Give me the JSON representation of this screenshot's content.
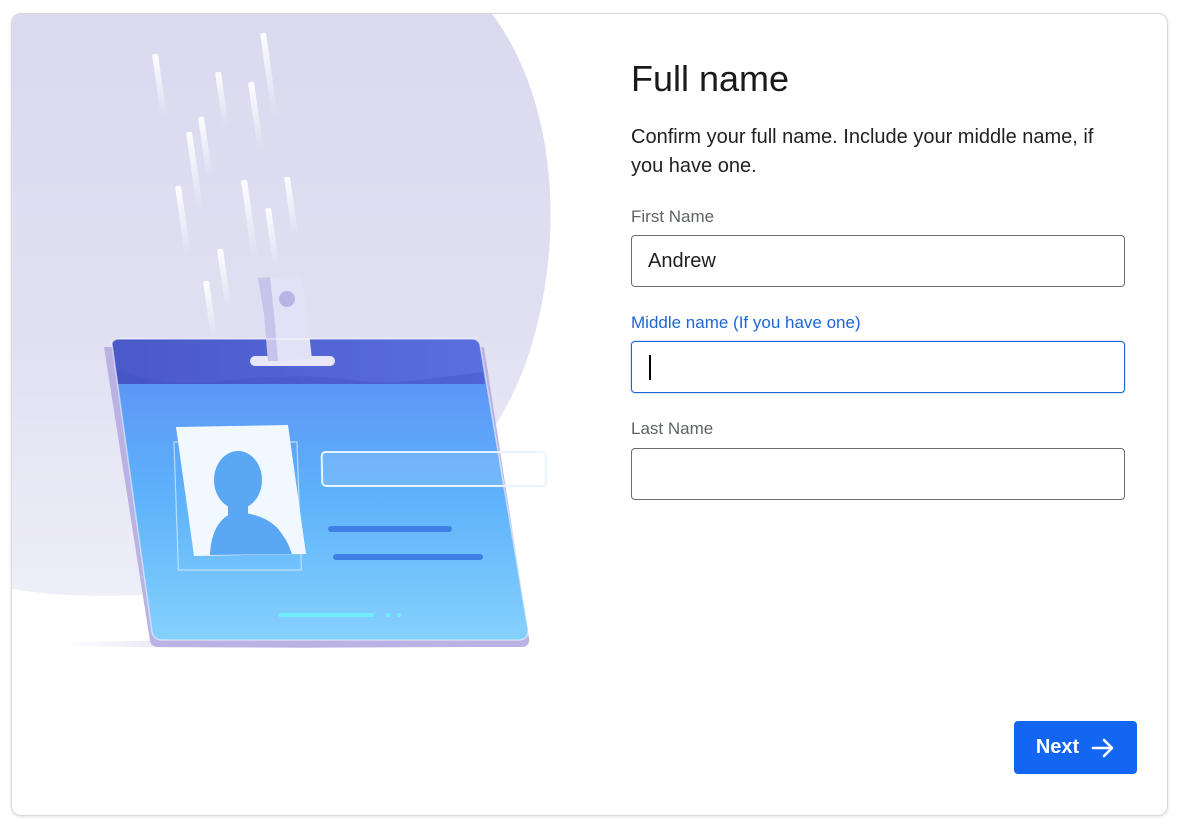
{
  "page": {
    "title": "Full name",
    "description": "Confirm your full name. Include your middle name, if you have one."
  },
  "fields": {
    "first_name": {
      "label": "First Name",
      "value": "Andrew"
    },
    "middle_name": {
      "label": "Middle name (If you have one)",
      "value": ""
    },
    "last_name": {
      "label": "Last Name",
      "value": ""
    }
  },
  "actions": {
    "next_label": "Next",
    "next_icon": "arrow-right-icon"
  },
  "illustration": {
    "name": "id-badge-illustration"
  },
  "colors": {
    "accent": "#1266f1",
    "focus_label": "#1a66d6",
    "blob": "#dcdcf0"
  }
}
